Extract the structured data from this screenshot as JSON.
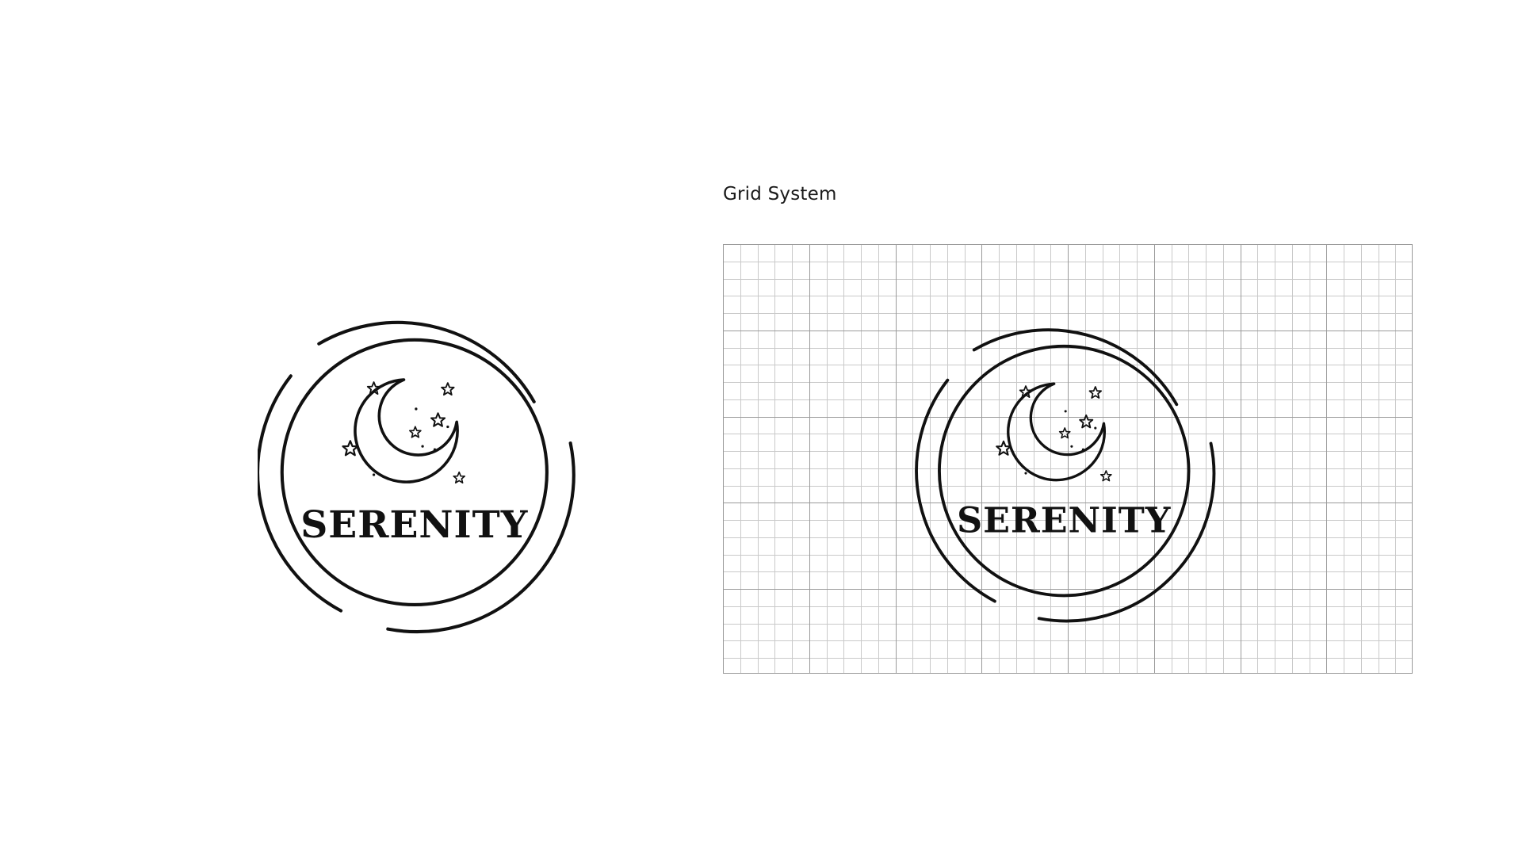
{
  "logo": {
    "wordmark": "SERENITY",
    "ink_color": "#111111",
    "icons": [
      "crescent-moon-icon",
      "star-icon"
    ]
  },
  "grid_section": {
    "title": "Grid System",
    "minor_line_color": "#c9c9c9",
    "major_line_color": "#9a9a9a"
  }
}
